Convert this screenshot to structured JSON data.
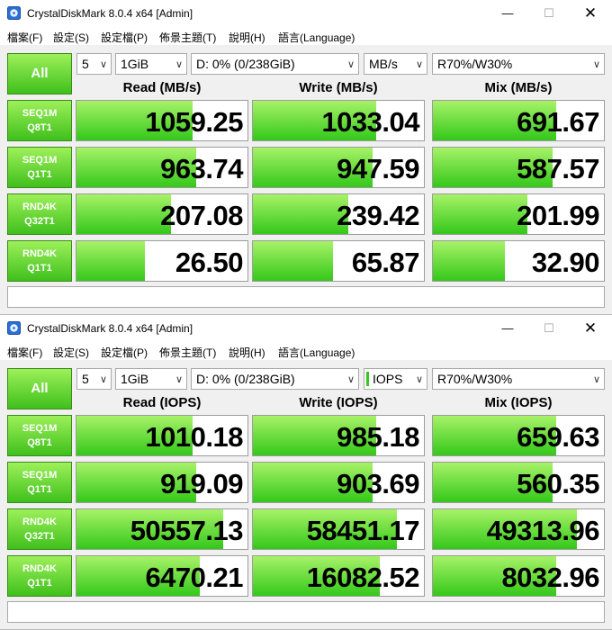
{
  "windows": [
    {
      "title": "CrystalDiskMark 8.0.4 x64 [Admin]",
      "window_controls": {
        "minimize": "—",
        "maximize": "☐",
        "close": "✕"
      },
      "menu": [
        "檔案(F)",
        "設定(S)",
        "設定檔(P)",
        "佈景主題(T)",
        "說明(H)",
        "語言(Language)"
      ],
      "all_button": "All",
      "combos": {
        "count": "5",
        "size": "1GiB",
        "drive": "D: 0% (0/238GiB)",
        "unit": "MB/s",
        "mix": "R70%/W30%"
      },
      "unit_marker": false,
      "headers": [
        "Read (MB/s)",
        "Write (MB/s)",
        "Mix (MB/s)"
      ],
      "rows": [
        {
          "l1": "SEQ1M",
          "l2": "Q8T1",
          "values": [
            "1059.25",
            "1033.04",
            "691.67"
          ],
          "fill": [
            0.68,
            0.72,
            0.72
          ]
        },
        {
          "l1": "SEQ1M",
          "l2": "Q1T1",
          "values": [
            "963.74",
            "947.59",
            "587.57"
          ],
          "fill": [
            0.7,
            0.7,
            0.7
          ]
        },
        {
          "l1": "RND4K",
          "l2": "Q32T1",
          "values": [
            "207.08",
            "239.42",
            "201.99"
          ],
          "fill": [
            0.55,
            0.56,
            0.55
          ]
        },
        {
          "l1": "RND4K",
          "l2": "Q1T1",
          "values": [
            "26.50",
            "65.87",
            "32.90"
          ],
          "fill": [
            0.4,
            0.47,
            0.42
          ]
        }
      ],
      "comment": ""
    },
    {
      "title": "CrystalDiskMark 8.0.4 x64 [Admin]",
      "window_controls": {
        "minimize": "—",
        "maximize": "☐",
        "close": "✕"
      },
      "menu": [
        "檔案(F)",
        "設定(S)",
        "設定檔(P)",
        "佈景主題(T)",
        "說明(H)",
        "語言(Language)"
      ],
      "all_button": "All",
      "combos": {
        "count": "5",
        "size": "1GiB",
        "drive": "D: 0% (0/238GiB)",
        "unit": "IOPS",
        "mix": "R70%/W30%"
      },
      "unit_marker": true,
      "headers": [
        "Read (IOPS)",
        "Write (IOPS)",
        "Mix (IOPS)"
      ],
      "rows": [
        {
          "l1": "SEQ1M",
          "l2": "Q8T1",
          "values": [
            "1010.18",
            "985.18",
            "659.63"
          ],
          "fill": [
            0.68,
            0.72,
            0.72
          ]
        },
        {
          "l1": "SEQ1M",
          "l2": "Q1T1",
          "values": [
            "919.09",
            "903.69",
            "560.35"
          ],
          "fill": [
            0.7,
            0.7,
            0.7
          ]
        },
        {
          "l1": "RND4K",
          "l2": "Q32T1",
          "values": [
            "50557.13",
            "58451.17",
            "49313.96"
          ],
          "fill": [
            0.86,
            0.84,
            0.84
          ]
        },
        {
          "l1": "RND4K",
          "l2": "Q1T1",
          "values": [
            "6470.21",
            "16082.52",
            "8032.96"
          ],
          "fill": [
            0.72,
            0.74,
            0.72
          ]
        }
      ],
      "comment": ""
    }
  ]
}
